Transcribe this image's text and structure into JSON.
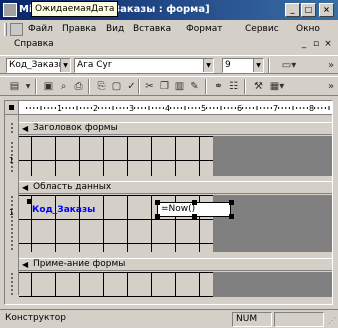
{
  "window": {
    "title_left": "Mi",
    "title_right": "Заказы : форма]",
    "tooltip": "ОжидаемаяДата",
    "minimize_label": "_",
    "maximize_label": "□",
    "close_label": "×"
  },
  "menu": {
    "items": [
      "Файл",
      "Правка",
      "Вид",
      "Вставка",
      "Формат",
      "Сервис",
      "Окно"
    ],
    "help_label": "Справка",
    "mdi_minimize": "_",
    "mdi_restore": "▫",
    "mdi_close": "×"
  },
  "format_toolbar": {
    "object_combo": "Код_Заказы",
    "font_combo": "Ага Cyr",
    "size_combo": "9"
  },
  "design": {
    "sections": {
      "header": "Заголовок формы",
      "detail": "Область данных",
      "footer": "Приме-ание формы"
    },
    "field": {
      "label": "Код_Заказы",
      "value": "=Now()"
    },
    "ruler_marks": [
      "1",
      "2",
      "3",
      "4",
      "5",
      "6",
      "7",
      "8",
      "9"
    ],
    "vruler_marks": [
      "1",
      "1"
    ]
  },
  "statusbar": {
    "mode": "Конструктор",
    "num": "NUM"
  },
  "colors": {
    "title_start": "#0a246a",
    "title_end": "#3a6ea5",
    "field_label": "#0000ff",
    "background": "#d4d0c8",
    "gray_area": "#808080"
  }
}
